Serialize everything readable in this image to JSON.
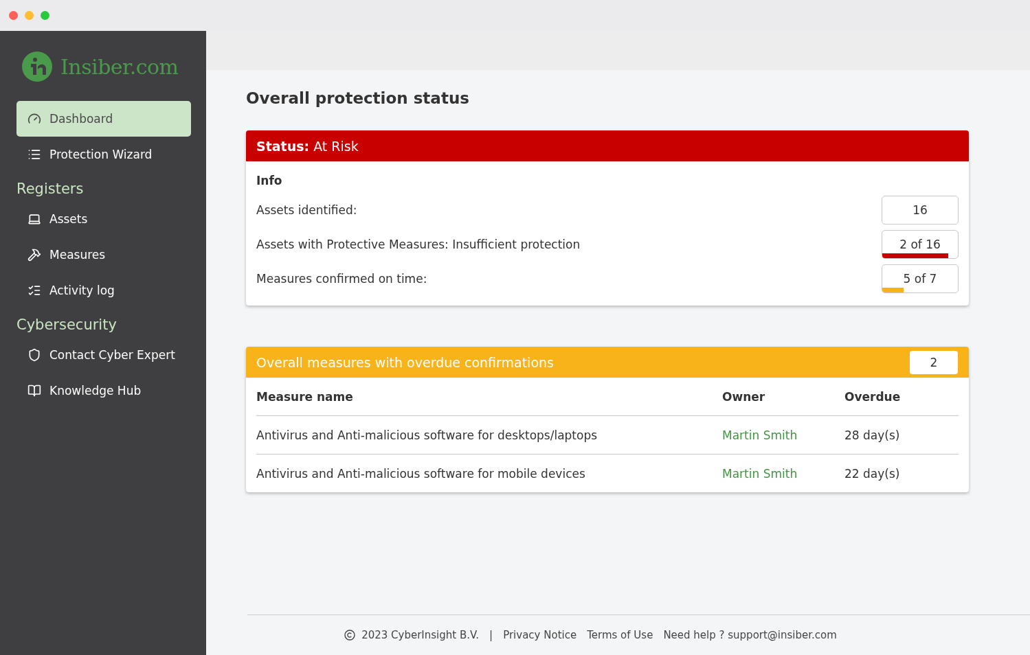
{
  "logo": {
    "text": "Insiber.com"
  },
  "nav": [
    {
      "kind": "item",
      "label": "Dashboard",
      "selected": true
    },
    {
      "kind": "item",
      "label": "Protection Wizard",
      "selected": false
    },
    {
      "kind": "heading",
      "label": "Registers"
    },
    {
      "kind": "item",
      "label": "Assets",
      "selected": false
    },
    {
      "kind": "item",
      "label": "Measures",
      "selected": false
    },
    {
      "kind": "item",
      "label": "Activity log",
      "selected": false
    },
    {
      "kind": "heading",
      "label": "Cybersecurity"
    },
    {
      "kind": "item",
      "label": "Contact Cyber Expert",
      "selected": false
    },
    {
      "kind": "item",
      "label": "Knowledge Hub",
      "selected": false
    }
  ],
  "page_title": "Overall protection status",
  "status_card": {
    "header": "**Status:**  At Risk",
    "section": "Info",
    "rows": [
      {
        "label": "Assets identified:",
        "value": "16"
      },
      {
        "label": "Assets with Protective Measures: Insufficient protection",
        "value": "2 of 16",
        "level": 0.87,
        "color": "#c80000"
      },
      {
        "label": "Measures confirmed on time:",
        "value": "5 of 7",
        "level": 0.28,
        "color": "#f9b31a"
      }
    ]
  },
  "overdue_card": {
    "header": "Overall measures with overdue confirmations",
    "count": "2",
    "columns": [
      "Measure name",
      "Owner",
      "Overdue"
    ],
    "rows": [
      [
        "Antivirus and Anti-malicious software for desktops/laptops",
        "Martin Smith",
        "28 day(s)"
      ],
      [
        "Antivirus and Anti-malicious software for mobile devices",
        "Martin Smith",
        "22 day(s)"
      ]
    ]
  },
  "footer": {
    "copyright": "2023  CyberInsight B.V.",
    "separator": "|",
    "links": [
      "Privacy Notice",
      "Terms of Use"
    ],
    "help": "Need help ? support@insiber.com"
  }
}
